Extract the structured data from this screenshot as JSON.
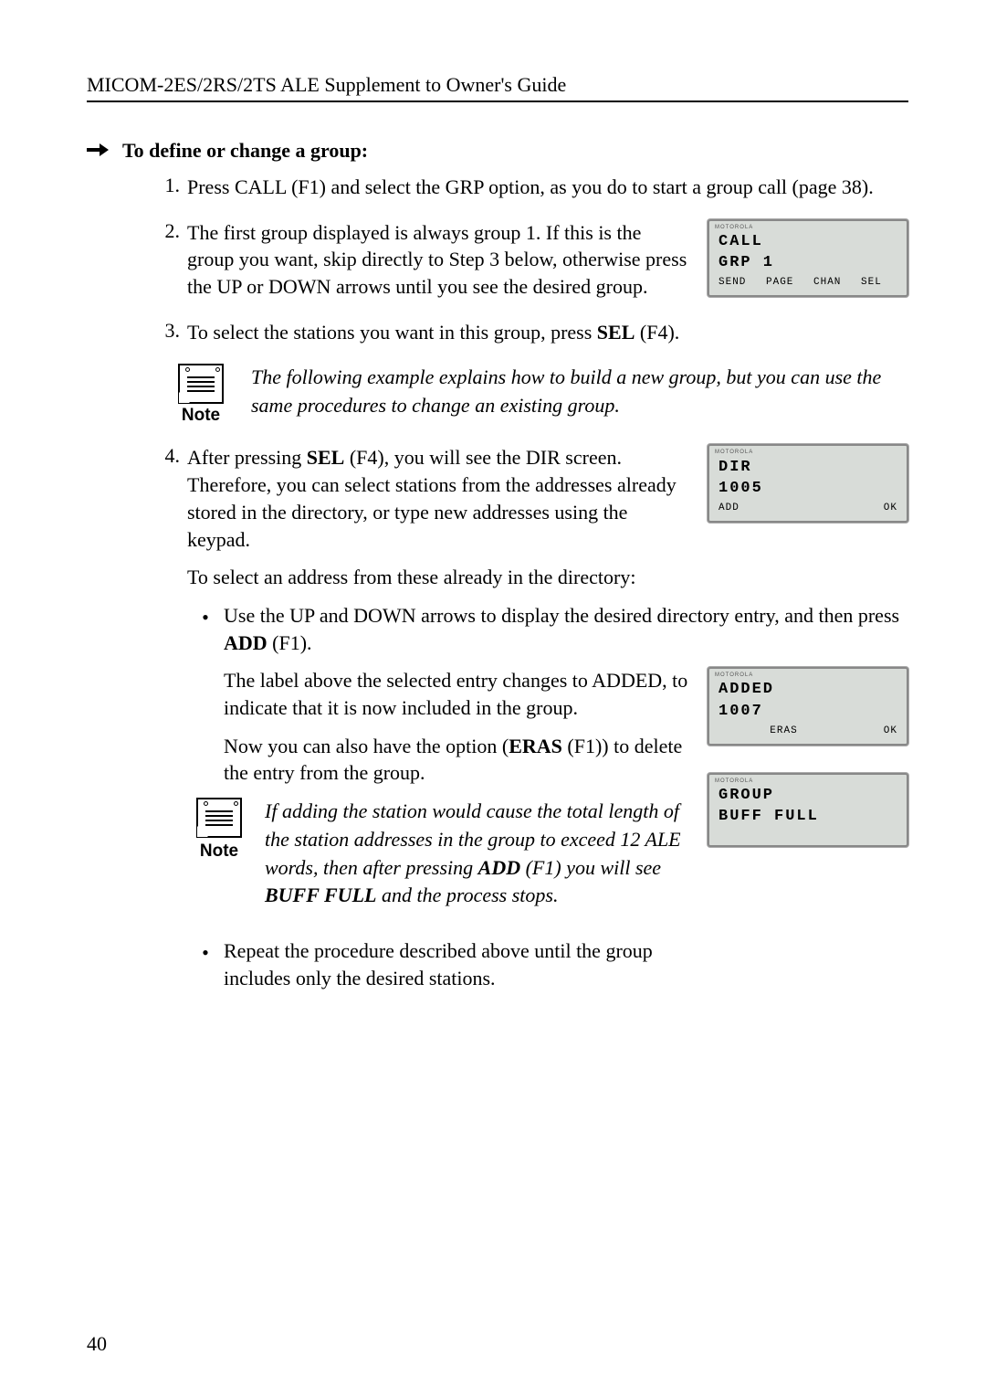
{
  "header": {
    "title": "MICOM-2ES/2RS/2TS ALE Supplement to Owner's Guide"
  },
  "heading": {
    "text": "To define or change a group:"
  },
  "steps": {
    "s1": {
      "num": "1.",
      "text": "Press CALL (F1) and select the GRP option, as you do to start a group call (page 38)."
    },
    "s2": {
      "num": "2.",
      "text": "The first group displayed is always group 1. If this is the group you want, skip directly to Step 3 below, otherwise press the UP or DOWN arrows until you see the desired group."
    },
    "s3": {
      "num": "3.",
      "prefix": "To select the stations you want in this group, press ",
      "sel": "SEL",
      "suffix": " (F4)."
    },
    "s4": {
      "num": "4.",
      "prefix": "After pressing ",
      "sel": "SEL",
      "suffix": " (F4), you will see the DIR screen. Therefore, you can select stations from the addresses already stored in the directory, or type new addresses using the keypad.",
      "sub1": "To select an address from these already in the directory:",
      "bullet1_prefix": "Use the UP and DOWN arrows to display the desired directory entry, and then press ",
      "bullet1_add": "ADD",
      "bullet1_suffix": " (F1).",
      "bullet1_para2": "The label above the selected entry changes to ADDED, to indicate that it is now included in the group.",
      "bullet1_para3_prefix": "Now you can also have the option (",
      "bullet1_para3_eras": "ERAS",
      "bullet1_para3_suffix": " (F1)) to delete the entry from the group.",
      "bullet2": "Repeat the procedure described above until the group includes only the desired stations."
    }
  },
  "notes": {
    "note1": {
      "label": "Note",
      "text": "The following example explains how to build a new group, but you can use the same procedures to change an existing group."
    },
    "note2": {
      "label": "Note",
      "prefix": "If adding the station would cause the total length of the station addresses in the group to exceed 12 ALE words, then after pressing ",
      "add": "ADD",
      "mid": " (F1) you will see ",
      "buff": "BUFF FULL",
      "suffix": " and the process stops."
    }
  },
  "lcd": {
    "brand": "MOTOROLA",
    "screen1": {
      "line1": "CALL",
      "line2": "GRP 1",
      "sk1": "SEND",
      "sk2": "PAGE",
      "sk3": "CHAN",
      "sk4": "SEL"
    },
    "screen2": {
      "line1": "DIR",
      "line2": "1005",
      "sk1": "ADD",
      "sk4": "OK"
    },
    "screen3": {
      "line1": "ADDED",
      "line2": "1007",
      "sk2": "ERAS",
      "sk4": "OK"
    },
    "screen4": {
      "line1": "GROUP",
      "line2": "BUFF FULL"
    }
  },
  "page_number": "40"
}
